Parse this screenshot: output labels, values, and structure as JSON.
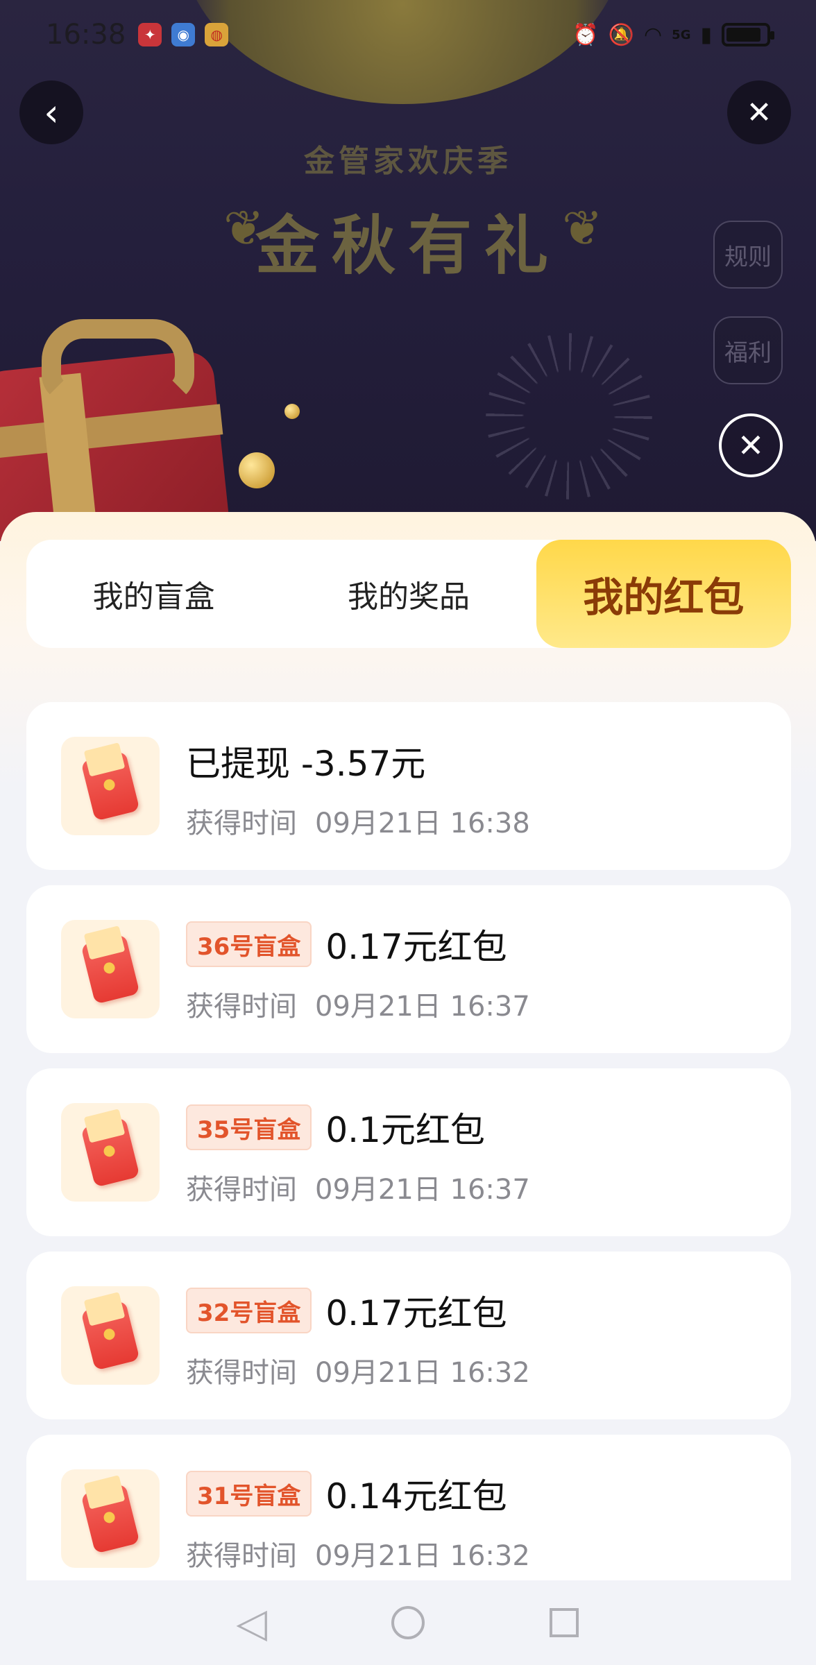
{
  "status_bar": {
    "time": "16:38",
    "network": "5G"
  },
  "banner": {
    "subtitle": "金管家欢庆季",
    "title": "金秋有礼",
    "rules_label": "规则",
    "welfare_label": "福利"
  },
  "tabs": [
    {
      "label": "我的盲盒",
      "active": false
    },
    {
      "label": "我的奖品",
      "active": false
    },
    {
      "label": "我的红包",
      "active": true
    }
  ],
  "records": [
    {
      "tag": "",
      "title": "已提现 -3.57元",
      "time_label": "获得时间",
      "time": "09月21日 16:38"
    },
    {
      "tag": "36号盲盒",
      "title": "0.17元红包",
      "time_label": "获得时间",
      "time": "09月21日 16:37"
    },
    {
      "tag": "35号盲盒",
      "title": "0.1元红包",
      "time_label": "获得时间",
      "time": "09月21日 16:37"
    },
    {
      "tag": "32号盲盒",
      "title": "0.17元红包",
      "time_label": "获得时间",
      "time": "09月21日 16:32"
    },
    {
      "tag": "31号盲盒",
      "title": "0.14元红包",
      "time_label": "获得时间",
      "time": "09月21日 16:32"
    }
  ],
  "icons": {
    "back": "chevron-left-icon",
    "close": "close-icon",
    "envelope": "red-envelope-icon"
  }
}
